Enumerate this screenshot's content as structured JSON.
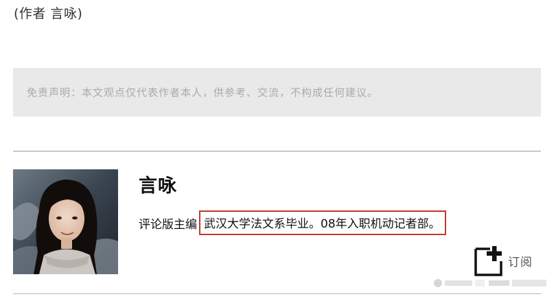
{
  "article": {
    "author_credit": "(作者 言咏)",
    "disclaimer": "免责声明：本文观点仅代表作者本人，供参考、交流，不构成任何建议。"
  },
  "author_card": {
    "name": "言咏",
    "title": "评论版主编",
    "bio_highlighted": "武汉大学法文系毕业。08年入职机动记者部。",
    "highlight_color": "#c0392b"
  },
  "subscribe": {
    "label": "订阅",
    "icon": "subscribe-plus-icon"
  },
  "colors": {
    "disclaimer_bg": "#e9e9e9",
    "disclaimer_text": "#aaaaaa",
    "divider": "#9a9a9a"
  }
}
